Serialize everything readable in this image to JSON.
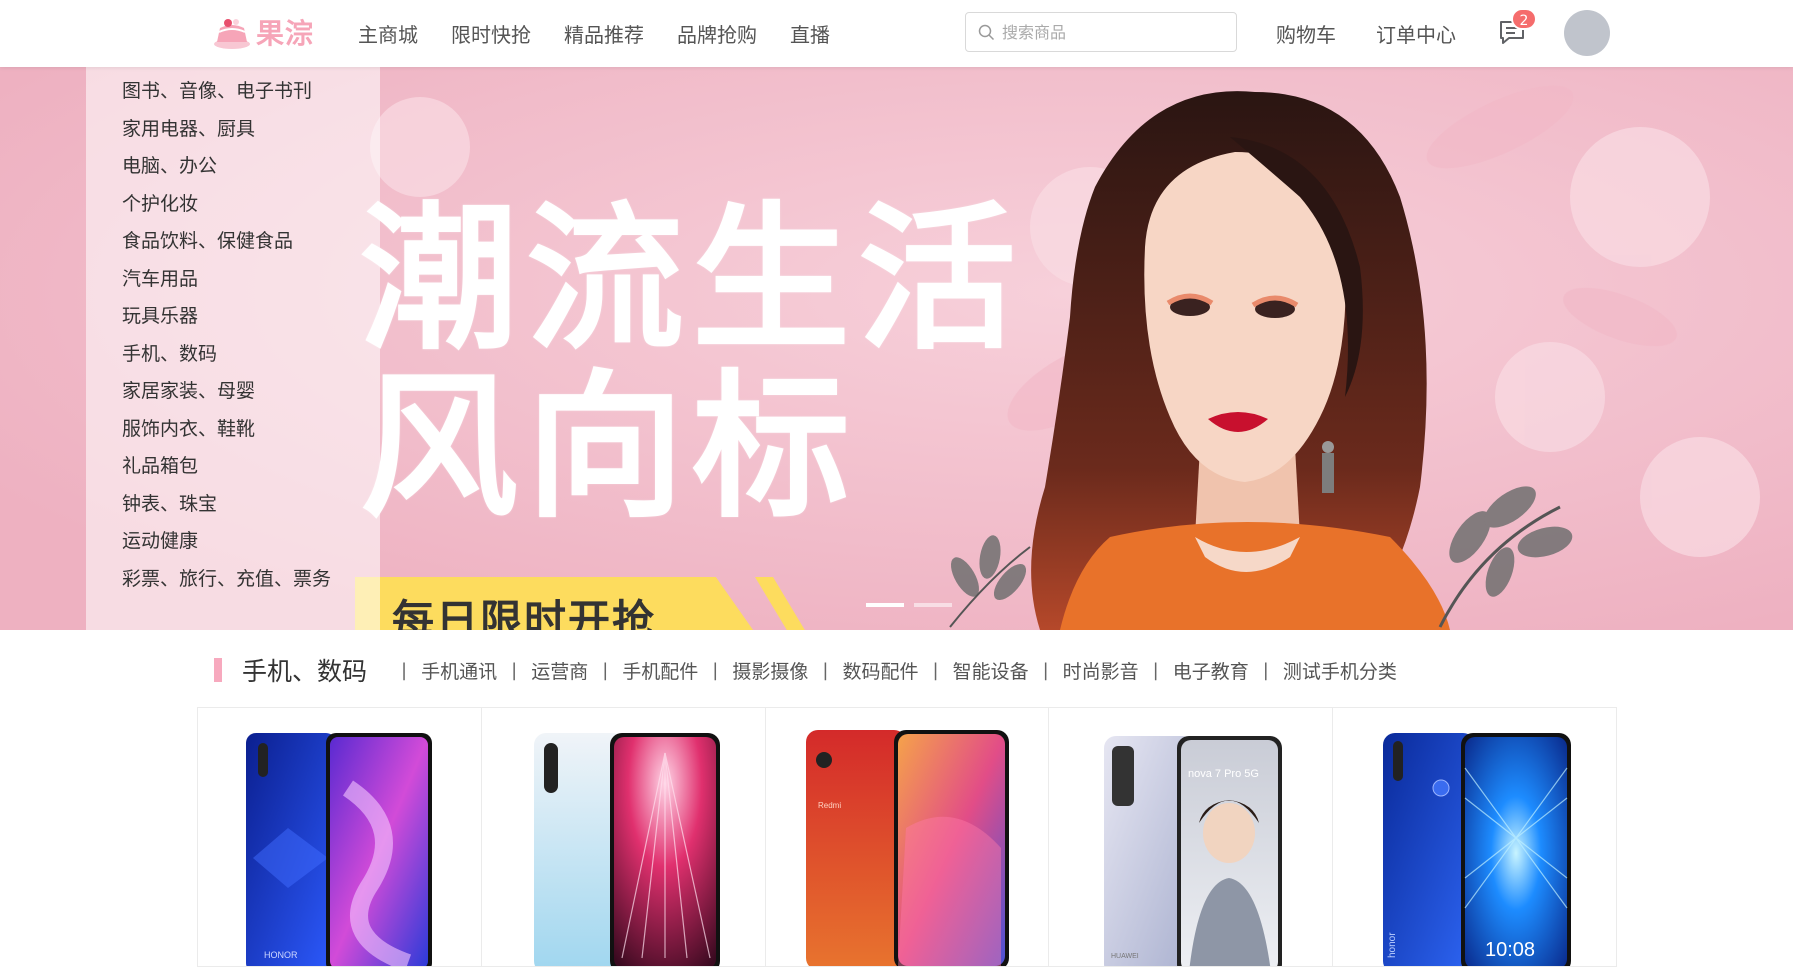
{
  "header": {
    "logo_text": "果淙",
    "nav": [
      "主商城",
      "限时快抢",
      "精品推荐",
      "品牌抢购",
      "直播"
    ],
    "search_placeholder": "搜索商品",
    "links": [
      "购物车",
      "订单中心"
    ],
    "message_count": "2"
  },
  "banner": {
    "slogan_line1": "潮流生活",
    "slogan_line2": "风向标",
    "flash_text": "每日限时开抢",
    "slides": 2,
    "active_slide": 1
  },
  "categories": [
    "图书、音像、电子书刊",
    "家用电器、厨具",
    "电脑、办公",
    "个护化妆",
    "食品饮料、保健食品",
    "汽车用品",
    "玩具乐器",
    "手机、数码",
    "家居家装、母婴",
    "服饰内衣、鞋靴",
    "礼品箱包",
    "钟表、珠宝",
    "运动健康",
    "彩票、旅行、充值、票务"
  ],
  "section": {
    "title": "手机、数码",
    "separator": "|",
    "sublinks": [
      "手机通讯",
      "运营商",
      "手机配件",
      "摄影摄像",
      "数码配件",
      "智能设备",
      "时尚影音",
      "电子教育",
      "测试手机分类"
    ]
  },
  "products": [
    {
      "brand": "HONOR",
      "screen_text": ""
    },
    {
      "brand": "",
      "screen_text": ""
    },
    {
      "brand": "Redmi",
      "screen_text": ""
    },
    {
      "brand": "HUAWEI",
      "screen_text": "nova 7 Pro 5G"
    },
    {
      "brand": "honor",
      "screen_text": "10:08"
    }
  ],
  "colors": {
    "accent_pink": "#f7a9be",
    "logo_pink": "#f6a5b8",
    "banner_bg": "#f3bccb",
    "badge_red": "#f56c6c",
    "flash_yellow": "#fddc5e"
  }
}
